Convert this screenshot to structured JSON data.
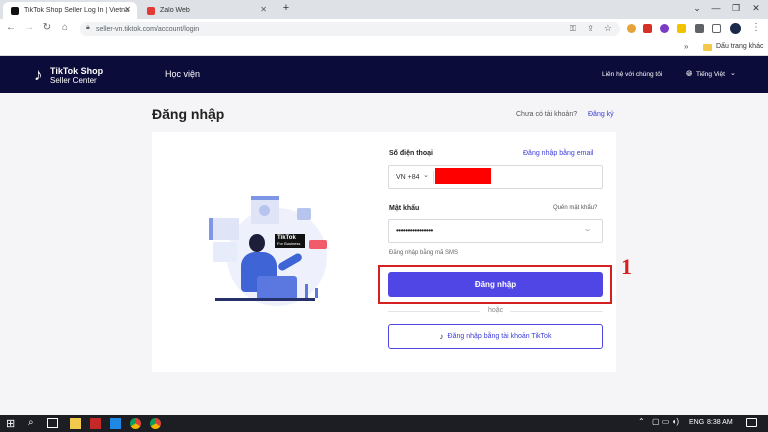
{
  "browser": {
    "tabs": [
      {
        "title": "TikTok Shop Seller Log In | Vietna",
        "active": true
      },
      {
        "title": "Zalo Web",
        "active": false
      }
    ],
    "url": "seller-vn.tiktok.com/account/login",
    "bookmarks": {
      "folder_label": "Dấu trang khác"
    }
  },
  "header": {
    "logo_line1": "TikTok Shop",
    "logo_line2": "Seller Center",
    "nav_academy": "Học viện",
    "contact": "Liên hệ với chúng tôi",
    "language": "Tiếng Việt"
  },
  "page": {
    "title": "Đăng nhập",
    "no_account": "Chưa có tài khoản?",
    "register": "Đăng ký"
  },
  "illustration": {
    "badge_text": "TikTok",
    "badge_sub": "For Business"
  },
  "form": {
    "phone_label": "Số điện thoại",
    "email_login_link": "Đăng nhập bằng email",
    "country_code": "VN +84",
    "password_label": "Mật khẩu",
    "forgot_password": "Quên mật khẩu?",
    "password_value": "••••••••••••••••",
    "sms_login": "Đăng nhập bằng mã SMS",
    "login_button": "Đăng nhập",
    "or_text": "hoặc",
    "tiktok_login_button": "Đăng nhập bằng tài khoản TikTok"
  },
  "annotation": {
    "step_number": "1",
    "color": "#d42020"
  },
  "taskbar": {
    "language": "ENG",
    "time": "8:38 AM"
  },
  "colors": {
    "header_bg": "#0c0c3a",
    "primary_button": "#5046e5",
    "link": "#3d3dd8",
    "redaction": "#ff0000"
  }
}
